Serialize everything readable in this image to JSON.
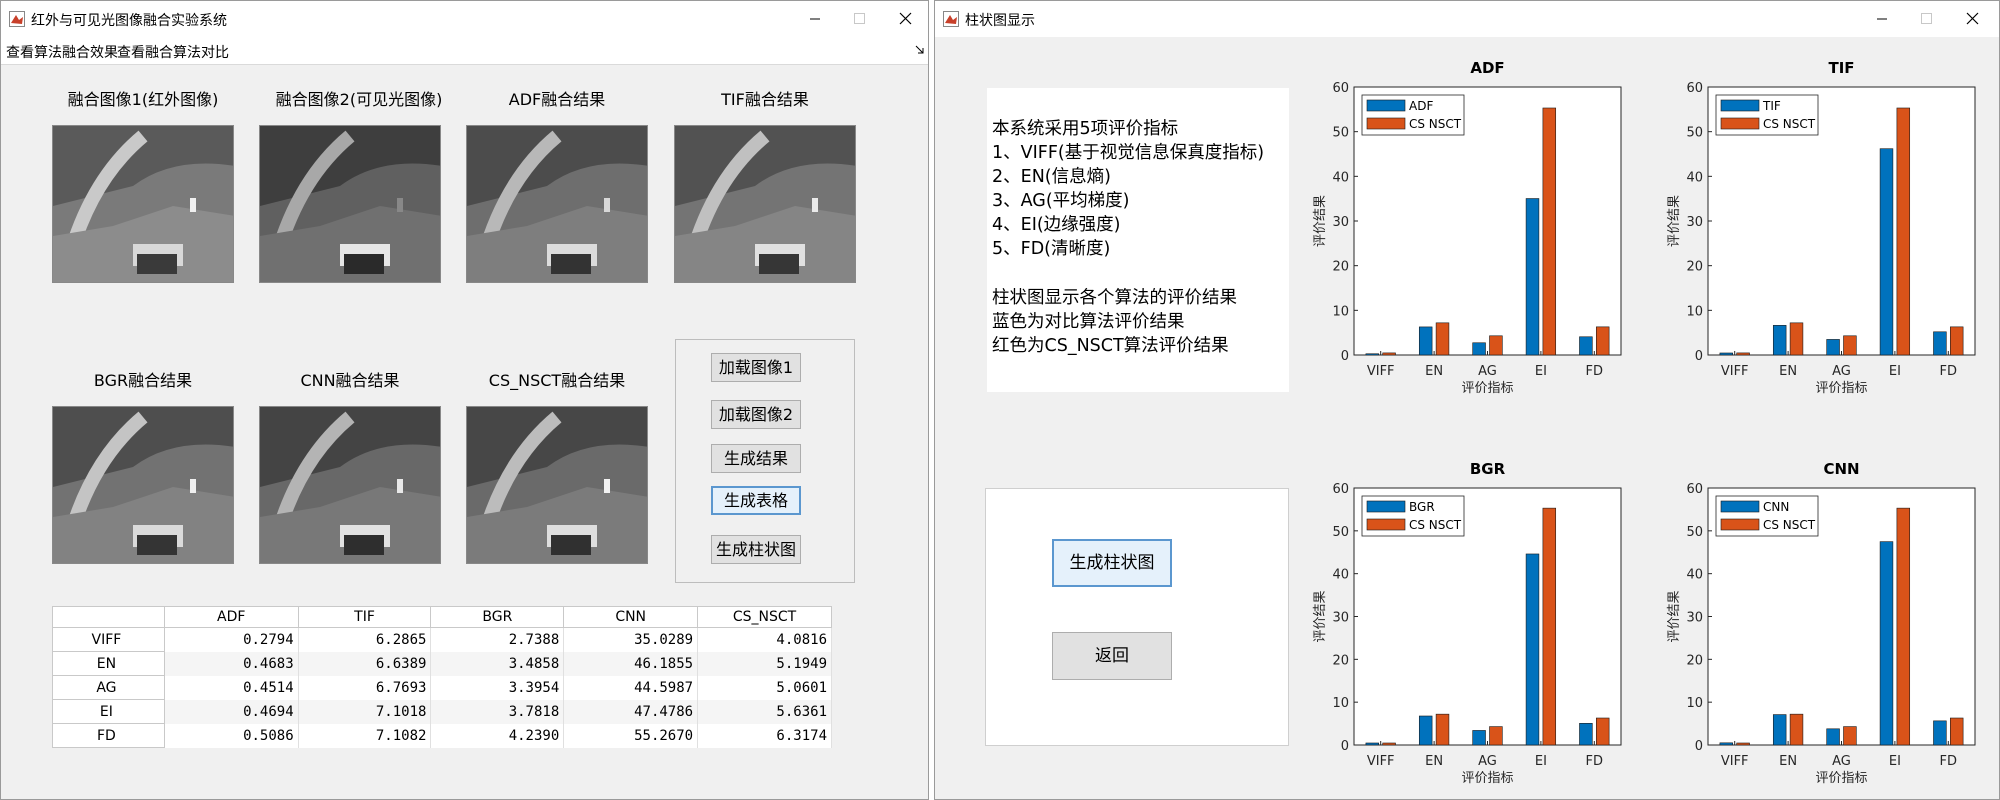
{
  "left_window": {
    "title": "红外与可见光图像融合实验系统",
    "menu": [
      "查看算法融合效果",
      "查看融合算法对比"
    ],
    "images": [
      {
        "caption": "融合图像1(红外图像)"
      },
      {
        "caption": "融合图像2(可见光图像)"
      },
      {
        "caption": "ADF融合结果"
      },
      {
        "caption": "TIF融合结果"
      },
      {
        "caption": "BGR融合结果"
      },
      {
        "caption": "CNN融合结果"
      },
      {
        "caption": "CS_NSCT融合结果"
      }
    ],
    "buttons": [
      "加载图像1",
      "加载图像2",
      "生成结果",
      "生成表格",
      "生成柱状图"
    ],
    "table": {
      "columns": [
        "ADF",
        "TIF",
        "BGR",
        "CNN",
        "CS_NSCT"
      ],
      "rows": [
        {
          "label": "VIFF",
          "cells": [
            "0.2794",
            "6.2865",
            "2.7388",
            "35.0289",
            "4.0816"
          ]
        },
        {
          "label": "EN",
          "cells": [
            "0.4683",
            "6.6389",
            "3.4858",
            "46.1855",
            "5.1949"
          ]
        },
        {
          "label": "AG",
          "cells": [
            "0.4514",
            "6.7693",
            "3.3954",
            "44.5987",
            "5.0601"
          ]
        },
        {
          "label": "EI",
          "cells": [
            "0.4694",
            "7.1018",
            "3.7818",
            "47.4786",
            "5.6361"
          ]
        },
        {
          "label": "FD",
          "cells": [
            "0.5086",
            "7.1082",
            "4.2390",
            "55.2670",
            "6.3174"
          ]
        }
      ]
    }
  },
  "right_window": {
    "title": "柱状图显示",
    "info_lines": [
      "本系统采用5项评价指标",
      "1、VIFF(基于视觉信息保真度指标)",
      "2、EN(信息熵)",
      "3、AG(平均梯度)",
      "4、EI(边缘强度)",
      "5、FD(清晰度)",
      "",
      "柱状图显示各个算法的评价结果",
      "蓝色为对比算法评价结果",
      "红色为CS_NSCT算法评价结果"
    ],
    "buttons": [
      "生成柱状图",
      "返回"
    ]
  },
  "colors": {
    "blue": "#0072bd",
    "orange": "#d95319"
  },
  "chart_data": [
    {
      "type": "bar",
      "title": "ADF",
      "categories": [
        "VIFF",
        "EN",
        "AG",
        "EI",
        "FD"
      ],
      "series": [
        {
          "name": "ADF",
          "values": [
            0.2794,
            6.2865,
            2.7388,
            35.0289,
            4.0816
          ]
        },
        {
          "name": "CS NSCT",
          "values": [
            0.4683,
            7.2,
            4.3,
            55.3,
            6.3
          ]
        }
      ],
      "xlabel": "评价指标",
      "ylabel": "评价结果",
      "ylim": [
        0,
        60
      ],
      "yticks": [
        0,
        10,
        20,
        30,
        40,
        50,
        60
      ],
      "legend": "top-left"
    },
    {
      "type": "bar",
      "title": "TIF",
      "categories": [
        "VIFF",
        "EN",
        "AG",
        "EI",
        "FD"
      ],
      "series": [
        {
          "name": "TIF",
          "values": [
            0.4514,
            6.6389,
            3.4858,
            46.1855,
            5.1949
          ]
        },
        {
          "name": "CS NSCT",
          "values": [
            0.4683,
            7.2,
            4.3,
            55.3,
            6.3
          ]
        }
      ],
      "xlabel": "评价指标",
      "ylabel": "评价结果",
      "ylim": [
        0,
        60
      ],
      "yticks": [
        0,
        10,
        20,
        30,
        40,
        50,
        60
      ],
      "legend": "top-left"
    },
    {
      "type": "bar",
      "title": "BGR",
      "categories": [
        "VIFF",
        "EN",
        "AG",
        "EI",
        "FD"
      ],
      "series": [
        {
          "name": "BGR",
          "values": [
            0.4694,
            6.7693,
            3.3954,
            44.5987,
            5.0601
          ]
        },
        {
          "name": "CS NSCT",
          "values": [
            0.4683,
            7.2,
            4.3,
            55.3,
            6.3
          ]
        }
      ],
      "xlabel": "评价指标",
      "ylabel": "评价结果",
      "ylim": [
        0,
        60
      ],
      "yticks": [
        0,
        10,
        20,
        30,
        40,
        50,
        60
      ],
      "legend": "top-left"
    },
    {
      "type": "bar",
      "title": "CNN",
      "categories": [
        "VIFF",
        "EN",
        "AG",
        "EI",
        "FD"
      ],
      "series": [
        {
          "name": "CNN",
          "values": [
            0.5086,
            7.1018,
            3.7818,
            47.4786,
            5.6361
          ]
        },
        {
          "name": "CS NSCT",
          "values": [
            0.4683,
            7.2,
            4.3,
            55.3,
            6.3
          ]
        }
      ],
      "xlabel": "评价指标",
      "ylabel": "评价结果",
      "ylim": [
        0,
        60
      ],
      "yticks": [
        0,
        10,
        20,
        30,
        40,
        50,
        60
      ],
      "legend": "top-left"
    }
  ]
}
